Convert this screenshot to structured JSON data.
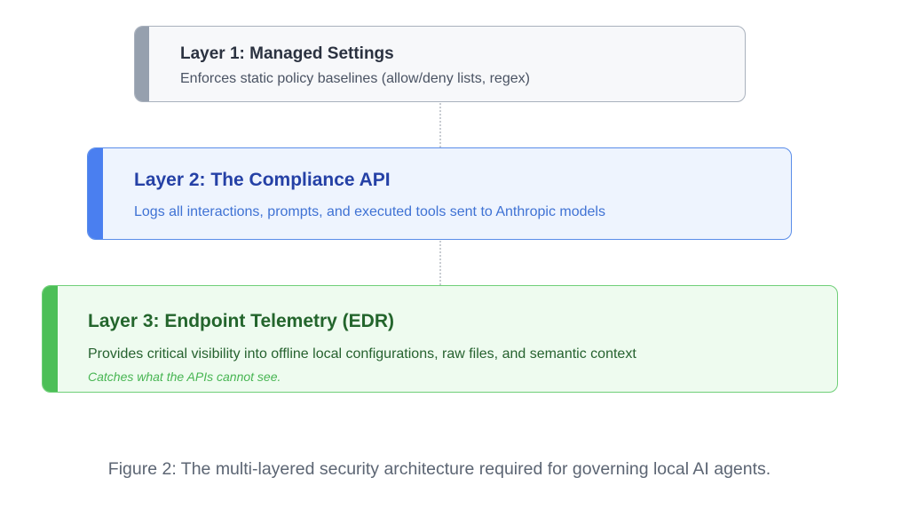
{
  "layers": [
    {
      "title": "Layer 1: Managed Settings",
      "description": "Enforces static policy baselines (allow/deny lists, regex)",
      "accent": "#96a0ae"
    },
    {
      "title": "Layer 2: The Compliance API",
      "description": "Logs all interactions, prompts, and executed tools sent to Anthropic models",
      "accent": "#4a7ff0"
    },
    {
      "title": "Layer 3: Endpoint Telemetry (EDR)",
      "description": "Provides critical visibility into offline local configurations, raw files, and semantic context",
      "note": "Catches what the APIs cannot see.",
      "accent": "#4cbf57"
    }
  ],
  "caption": "Figure 2: The multi-layered security architecture required for governing local AI agents."
}
